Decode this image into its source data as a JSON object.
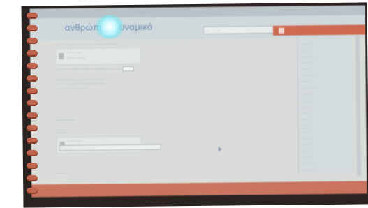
{
  "window": {
    "page_title": "ανθρώπινο δυναμικό",
    "topbar_text": "· · · · · · · ·"
  },
  "search": {
    "placeholder": "...",
    "button": "→"
  },
  "header_right": {
    "label": "· · ·"
  },
  "content": {
    "lines": [
      "·· ··· ·· ······ ··· · ··· ·· ·· ·········· ···········",
      "·· · ··· ·· · ······· ··· ······ ·· ········ ·· ··· ·······",
      "···· ·· ··· ······ ···· ·· ···· ······ ·····",
      "···· ·· ··· ······ ···· ·· ···· ······ ·····",
      "········· ········",
      "·········",
      "········"
    ],
    "link": "·········· ·· ·· ·· ········"
  },
  "files": [
    {
      "name": "········ ····",
      "download": "·······  ········"
    },
    {
      "name": "········ ···",
      "download": "······ ········"
    }
  ],
  "bottom_input": "···· ········ ········ ··· ·· ··",
  "sidebar": {
    "items": [
      "·········",
      "·······",
      "···· ·· ·····",
      "·········",
      "······",
      "········· ···",
      "·······",
      "········ ·· ···",
      "········",
      "·········",
      "·······",
      "······",
      "········",
      "·····",
      "······",
      "········",
      "·······",
      "·····",
      "········",
      "······ ·····",
      "········ ·· ·"
    ]
  },
  "colors": {
    "accent": "#cf6a52",
    "link": "#5877a8",
    "title": "#6e89b3",
    "screen_bg": "#d9dcd8"
  }
}
